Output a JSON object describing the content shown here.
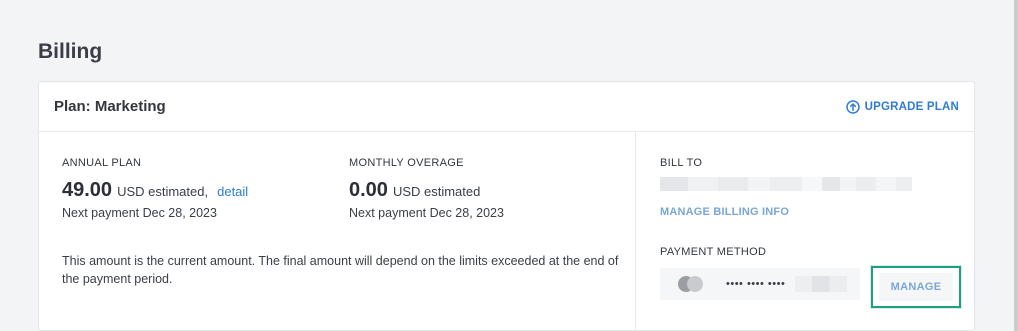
{
  "page": {
    "title": "Billing"
  },
  "plan_card": {
    "title": "Plan: Marketing",
    "upgrade_label": "UPGRADE PLAN",
    "upgrade_icon": "circle-arrow-up-icon",
    "accent_color": "#2f7dd3"
  },
  "annual": {
    "label": "ANNUAL PLAN",
    "amount": "49.00",
    "unit": "USD estimated,",
    "detail_link": "detail",
    "next_payment": "Next payment Dec 28, 2023"
  },
  "overage": {
    "label": "MONTHLY OVERAGE",
    "amount": "0.00",
    "unit": "USD estimated",
    "next_payment": "Next payment Dec 28, 2023"
  },
  "note": "This amount is the current amount. The final amount will depend on the limits exceeded at the end of the payment period.",
  "bill_to": {
    "label": "BILL TO",
    "manage_link": "MANAGE BILLING INFO"
  },
  "payment_method": {
    "label": "PAYMENT METHOD",
    "card_icon": "credit-card-icon",
    "masked_number": "•••• •••• ••••",
    "manage_label": "MANAGE",
    "highlight_color": "#1f9e82"
  }
}
